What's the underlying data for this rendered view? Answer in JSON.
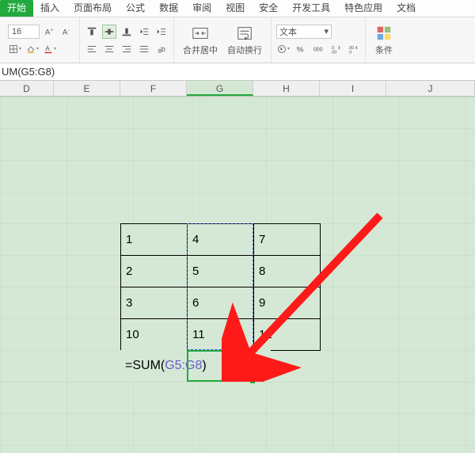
{
  "tabs": {
    "items": [
      "开始",
      "插入",
      "页面布局",
      "公式",
      "数据",
      "审阅",
      "视图",
      "安全",
      "开发工具",
      "特色应用",
      "文档"
    ],
    "active_index": 0
  },
  "ribbon": {
    "font_size": "16",
    "merge_label": "合并居中",
    "wrap_label": "自动换行",
    "number_format": "文本",
    "cond_fmt_label": "条件"
  },
  "formula_bar": {
    "text": "UM(G5:G8)"
  },
  "columns": [
    "D",
    "E",
    "F",
    "G",
    "H",
    "I",
    "J"
  ],
  "selected_col_index": 3,
  "chart_data": {
    "type": "table",
    "range": "F5:H8",
    "columns": [
      "F",
      "G",
      "H"
    ],
    "rows": [
      {
        "F": 1,
        "G": 4,
        "H": 7
      },
      {
        "F": 2,
        "G": 5,
        "H": 8
      },
      {
        "F": 3,
        "G": 6,
        "H": 9
      },
      {
        "F": 10,
        "G": 11,
        "H": 12
      }
    ],
    "formula_cell": {
      "address": "F9",
      "display": "=SUM(G5:G8)",
      "ref_range": "G5:G8"
    }
  }
}
